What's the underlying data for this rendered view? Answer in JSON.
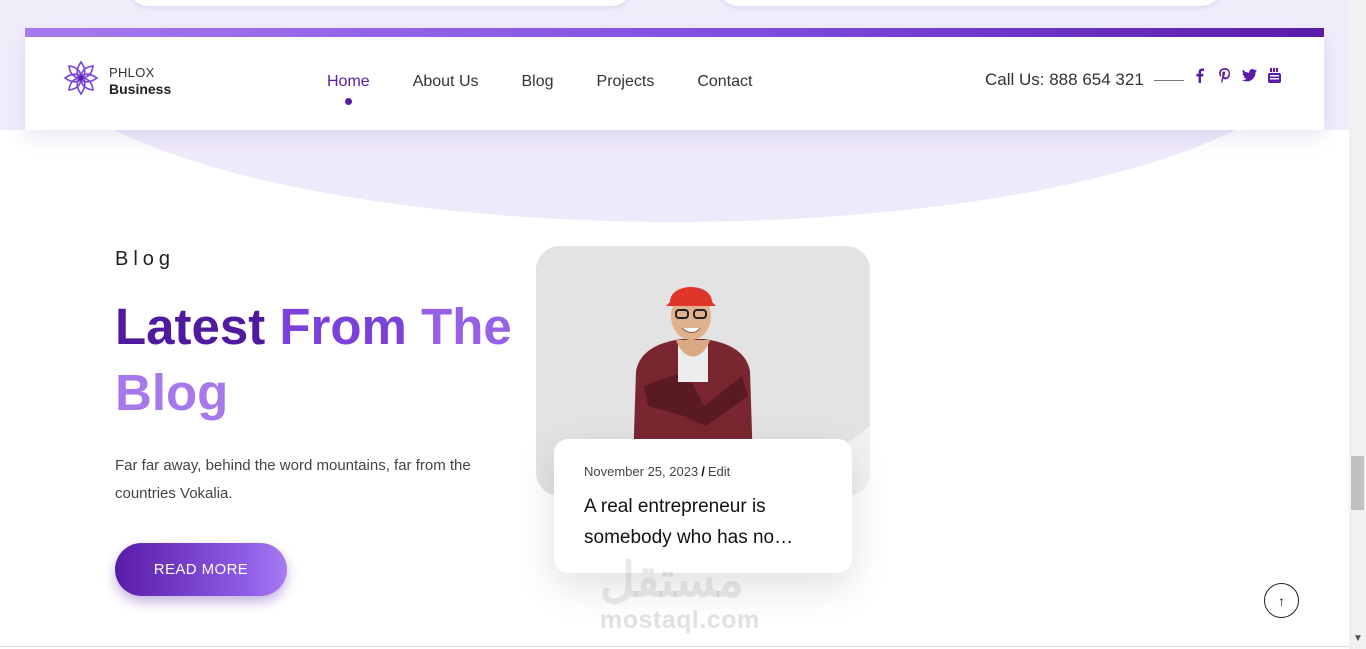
{
  "brand": {
    "line1": "PHLOX",
    "line2": "Business"
  },
  "nav": {
    "items": [
      {
        "label": "Home"
      },
      {
        "label": "About Us"
      },
      {
        "label": "Blog"
      },
      {
        "label": "Projects"
      },
      {
        "label": "Contact"
      }
    ],
    "active_index": 0
  },
  "header": {
    "call": "Call Us: 888 654 321",
    "social": [
      "facebook-icon",
      "pinterest-icon",
      "twitter-icon",
      "youtube-icon"
    ]
  },
  "section": {
    "kicker": "Blog",
    "headline": {
      "word1": "Latest",
      "word2": "From",
      "word3": "The",
      "word4": "Blog"
    },
    "description": "Far far away, behind the word mountains, far from the countries Vokalia.",
    "button": "READ MORE"
  },
  "post": {
    "date": "November 25, 2023",
    "separator": "/",
    "edit": "Edit",
    "title": "A real entrepreneur is somebody who has no…"
  },
  "watermark": {
    "arabic": "مستقل",
    "latin": "mostaql.com"
  },
  "scroll_top_icon": "↑",
  "colors": {
    "primary": "#5a1ca8",
    "accent": "#8d5be6",
    "lavender": "#efeafb"
  }
}
